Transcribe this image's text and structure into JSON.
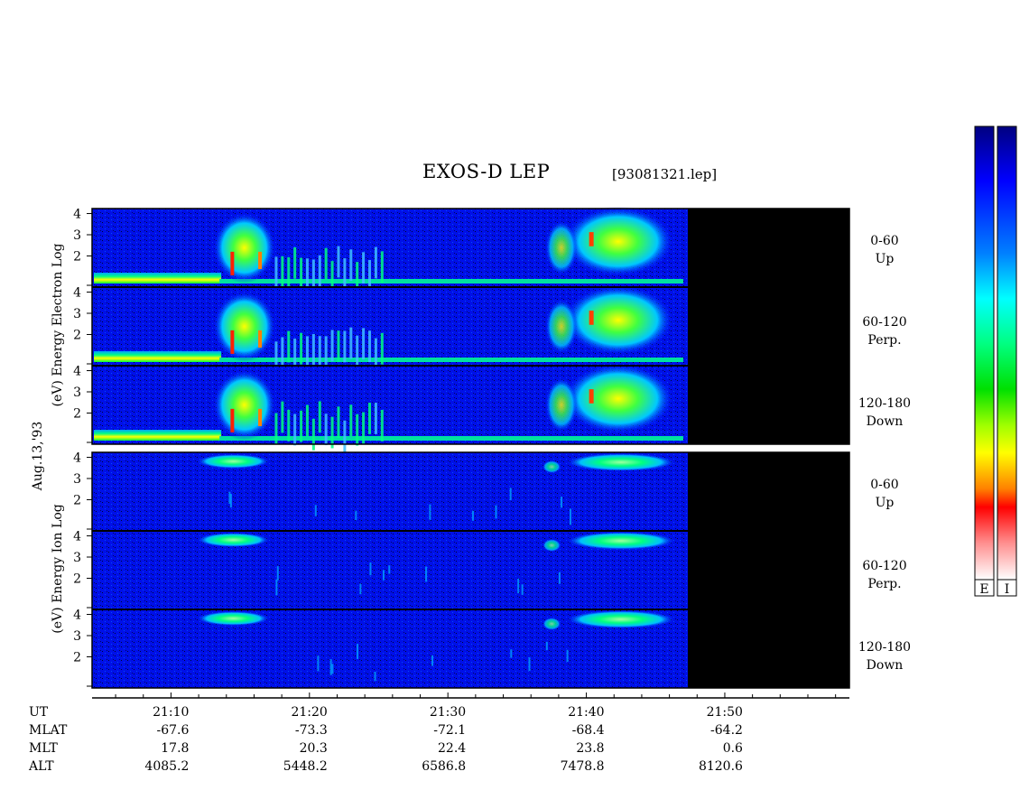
{
  "chart_data": {
    "type": "heatmap",
    "title": "EXOS-D LEP",
    "file_label": "[93081321.lep]",
    "date_label": "Aug.13,'93",
    "electron_ylabel": [
      "Log",
      "Electron",
      "Energy",
      "(eV)"
    ],
    "ion_ylabel": [
      "Log",
      "Ion",
      "Energy",
      "(eV)"
    ],
    "y_ticks": [
      "4",
      "3",
      "2"
    ],
    "panel_labels": [
      {
        "angle": "0-60",
        "dir": "Up"
      },
      {
        "angle": "60-120",
        "dir": "Perp."
      },
      {
        "angle": "120-180",
        "dir": "Down"
      }
    ],
    "x_ticks": [
      "21:10",
      "21:20",
      "21:30",
      "21:40",
      "21:50"
    ],
    "ephemeris": [
      {
        "name": "UT",
        "values": [
          "21:10",
          "21:20",
          "21:30",
          "21:40",
          "21:50"
        ]
      },
      {
        "name": "MLAT",
        "values": [
          "-67.6",
          "-73.3",
          "-72.1",
          "-68.4",
          "-64.2"
        ]
      },
      {
        "name": "MLT",
        "values": [
          "17.8",
          "20.3",
          "22.4",
          "23.8",
          "0.6"
        ]
      },
      {
        "name": "ALT",
        "values": [
          "4085.2",
          "5448.2",
          "6586.8",
          "7478.8",
          "8120.6"
        ]
      }
    ],
    "colorbar_labels": [
      "E",
      "I"
    ],
    "data_end_time": "21:48"
  }
}
